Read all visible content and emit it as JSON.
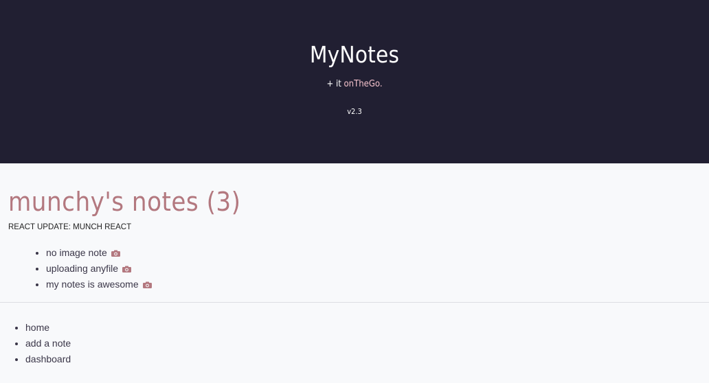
{
  "hero": {
    "title": "MyNotes",
    "tagline_prefix": "+ it ",
    "tagline_highlight": "onTheGo.",
    "version": "v2.3"
  },
  "notes": {
    "heading": "munchy's notes (3)",
    "update_text": "REACT UPDATE: MUNCH REACT",
    "items": [
      {
        "label": "no image note",
        "icon": "camera-icon"
      },
      {
        "label": "uploading anyfile",
        "icon": "camera-icon"
      },
      {
        "label": "my notes is awesome",
        "icon": "camera-icon"
      }
    ]
  },
  "nav": {
    "items": [
      {
        "label": "home"
      },
      {
        "label": "add a note"
      },
      {
        "label": "dashboard"
      }
    ]
  },
  "colors": {
    "hero_bg": "#211f32",
    "accent": "#b3787f",
    "highlight": "#f4c2cc",
    "page_bg": "#f8f9fb",
    "text": "#3a3648"
  }
}
